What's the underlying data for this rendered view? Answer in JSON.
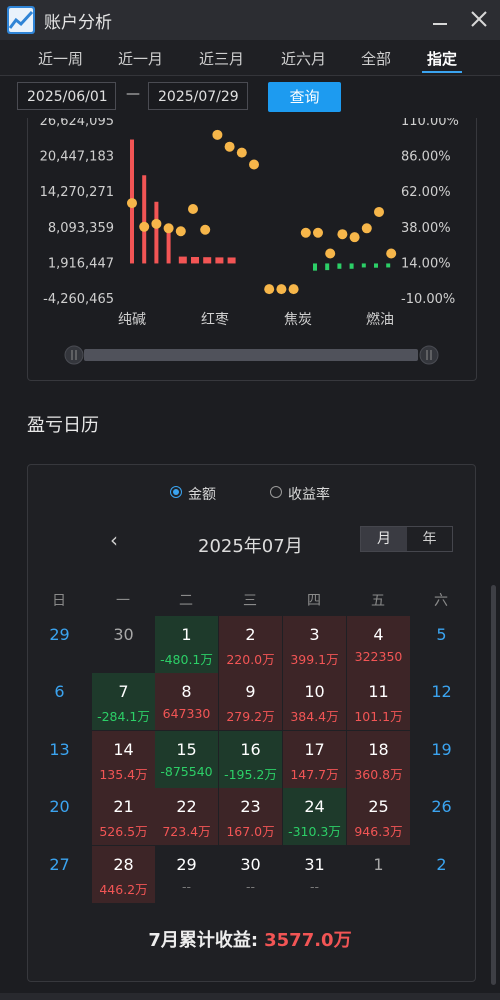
{
  "window": {
    "title": "账户分析"
  },
  "tabs": [
    {
      "label": "近一周",
      "active": false
    },
    {
      "label": "近一月",
      "active": false
    },
    {
      "label": "近三月",
      "active": false
    },
    {
      "label": "近六月",
      "active": false
    },
    {
      "label": "全部",
      "active": false
    },
    {
      "label": "指定",
      "active": true
    }
  ],
  "date_range": {
    "start": "2025/06/01",
    "separator": "—",
    "end": "2025/07/29",
    "query_label": "查询"
  },
  "colors": {
    "accent": "#1d9bf0",
    "positive": "#f25555",
    "negative": "#2ccf67",
    "point": "#f6b64a",
    "weekend": "#3ba4f0"
  },
  "chart_data": {
    "type": "bar",
    "note_overlay": "line-points",
    "left_axis": {
      "ticks": [
        "26,624,095",
        "20,447,183",
        "14,270,271",
        "8,093,359",
        "1,916,447",
        "-4,260,465"
      ],
      "range": [
        -4260465,
        26624095
      ]
    },
    "right_axis": {
      "ticks": [
        "110.00%",
        "86.00%",
        "62.00%",
        "38.00%",
        "14.00%",
        "-10.00%"
      ],
      "range": [
        -10,
        110
      ]
    },
    "x_labels": [
      "纯碱",
      "红枣",
      "焦炭",
      "燃油"
    ],
    "bars": [
      21500000,
      15300000,
      10700000,
      6600000,
      1700000,
      1600000,
      1550000,
      1500000,
      1480000,
      0,
      0,
      0,
      0,
      0,
      0,
      1350000,
      1250000,
      1000000,
      1000000,
      600000,
      800000,
      700000
    ],
    "points": [
      54,
      38,
      40,
      37,
      35,
      50,
      36,
      100,
      92,
      88,
      80,
      -4,
      -4,
      -4,
      34,
      34,
      20,
      33,
      31,
      37,
      48,
      20
    ],
    "scroll_handles": [
      "left-handle",
      "right-handle"
    ]
  },
  "calendar": {
    "heading": "盈亏日历",
    "mode_options": [
      {
        "label": "金额",
        "selected": true
      },
      {
        "label": "收益率",
        "selected": false
      }
    ],
    "prev_icon": "‹",
    "month_title": "2025年07月",
    "view_options": {
      "month": "月",
      "year": "年"
    },
    "weekdays": [
      "日",
      "一",
      "二",
      "三",
      "四",
      "五",
      "六"
    ],
    "weeks": [
      [
        {
          "day": "29",
          "value": "",
          "type": "wk"
        },
        {
          "day": "30",
          "value": "",
          "type": "out"
        },
        {
          "day": "1",
          "value": "-480.1万",
          "type": "neg"
        },
        {
          "day": "2",
          "value": "220.0万",
          "type": "pos"
        },
        {
          "day": "3",
          "value": "399.1万",
          "type": "pos"
        },
        {
          "day": "4",
          "value": "322350",
          "type": "pos"
        },
        {
          "day": "5",
          "value": "",
          "type": "wk"
        }
      ],
      [
        {
          "day": "6",
          "value": "",
          "type": "wk"
        },
        {
          "day": "7",
          "value": "-284.1万",
          "type": "neg"
        },
        {
          "day": "8",
          "value": "647330",
          "type": "pos"
        },
        {
          "day": "9",
          "value": "279.2万",
          "type": "pos"
        },
        {
          "day": "10",
          "value": "384.4万",
          "type": "pos"
        },
        {
          "day": "11",
          "value": "101.1万",
          "type": "pos"
        },
        {
          "day": "12",
          "value": "",
          "type": "wk"
        }
      ],
      [
        {
          "day": "13",
          "value": "",
          "type": "wk"
        },
        {
          "day": "14",
          "value": "135.4万",
          "type": "pos"
        },
        {
          "day": "15",
          "value": "-875540",
          "type": "neg"
        },
        {
          "day": "16",
          "value": "-195.2万",
          "type": "neg"
        },
        {
          "day": "17",
          "value": "147.7万",
          "type": "pos"
        },
        {
          "day": "18",
          "value": "360.8万",
          "type": "pos"
        },
        {
          "day": "19",
          "value": "",
          "type": "wk"
        }
      ],
      [
        {
          "day": "20",
          "value": "",
          "type": "wk"
        },
        {
          "day": "21",
          "value": "526.5万",
          "type": "pos"
        },
        {
          "day": "22",
          "value": "723.4万",
          "type": "pos"
        },
        {
          "day": "23",
          "value": "167.0万",
          "type": "pos"
        },
        {
          "day": "24",
          "value": "-310.3万",
          "type": "neg"
        },
        {
          "day": "25",
          "value": "946.3万",
          "type": "pos"
        },
        {
          "day": "26",
          "value": "",
          "type": "wk"
        }
      ],
      [
        {
          "day": "27",
          "value": "",
          "type": "wk"
        },
        {
          "day": "28",
          "value": "446.2万",
          "type": "pos"
        },
        {
          "day": "29",
          "value": "--",
          "type": "fut"
        },
        {
          "day": "30",
          "value": "--",
          "type": "fut"
        },
        {
          "day": "31",
          "value": "--",
          "type": "fut"
        },
        {
          "day": "1",
          "value": "",
          "type": "out"
        },
        {
          "day": "2",
          "value": "",
          "type": "wk"
        }
      ]
    ],
    "summary_label": "7月累计收益:",
    "summary_value": "3577.0万"
  }
}
